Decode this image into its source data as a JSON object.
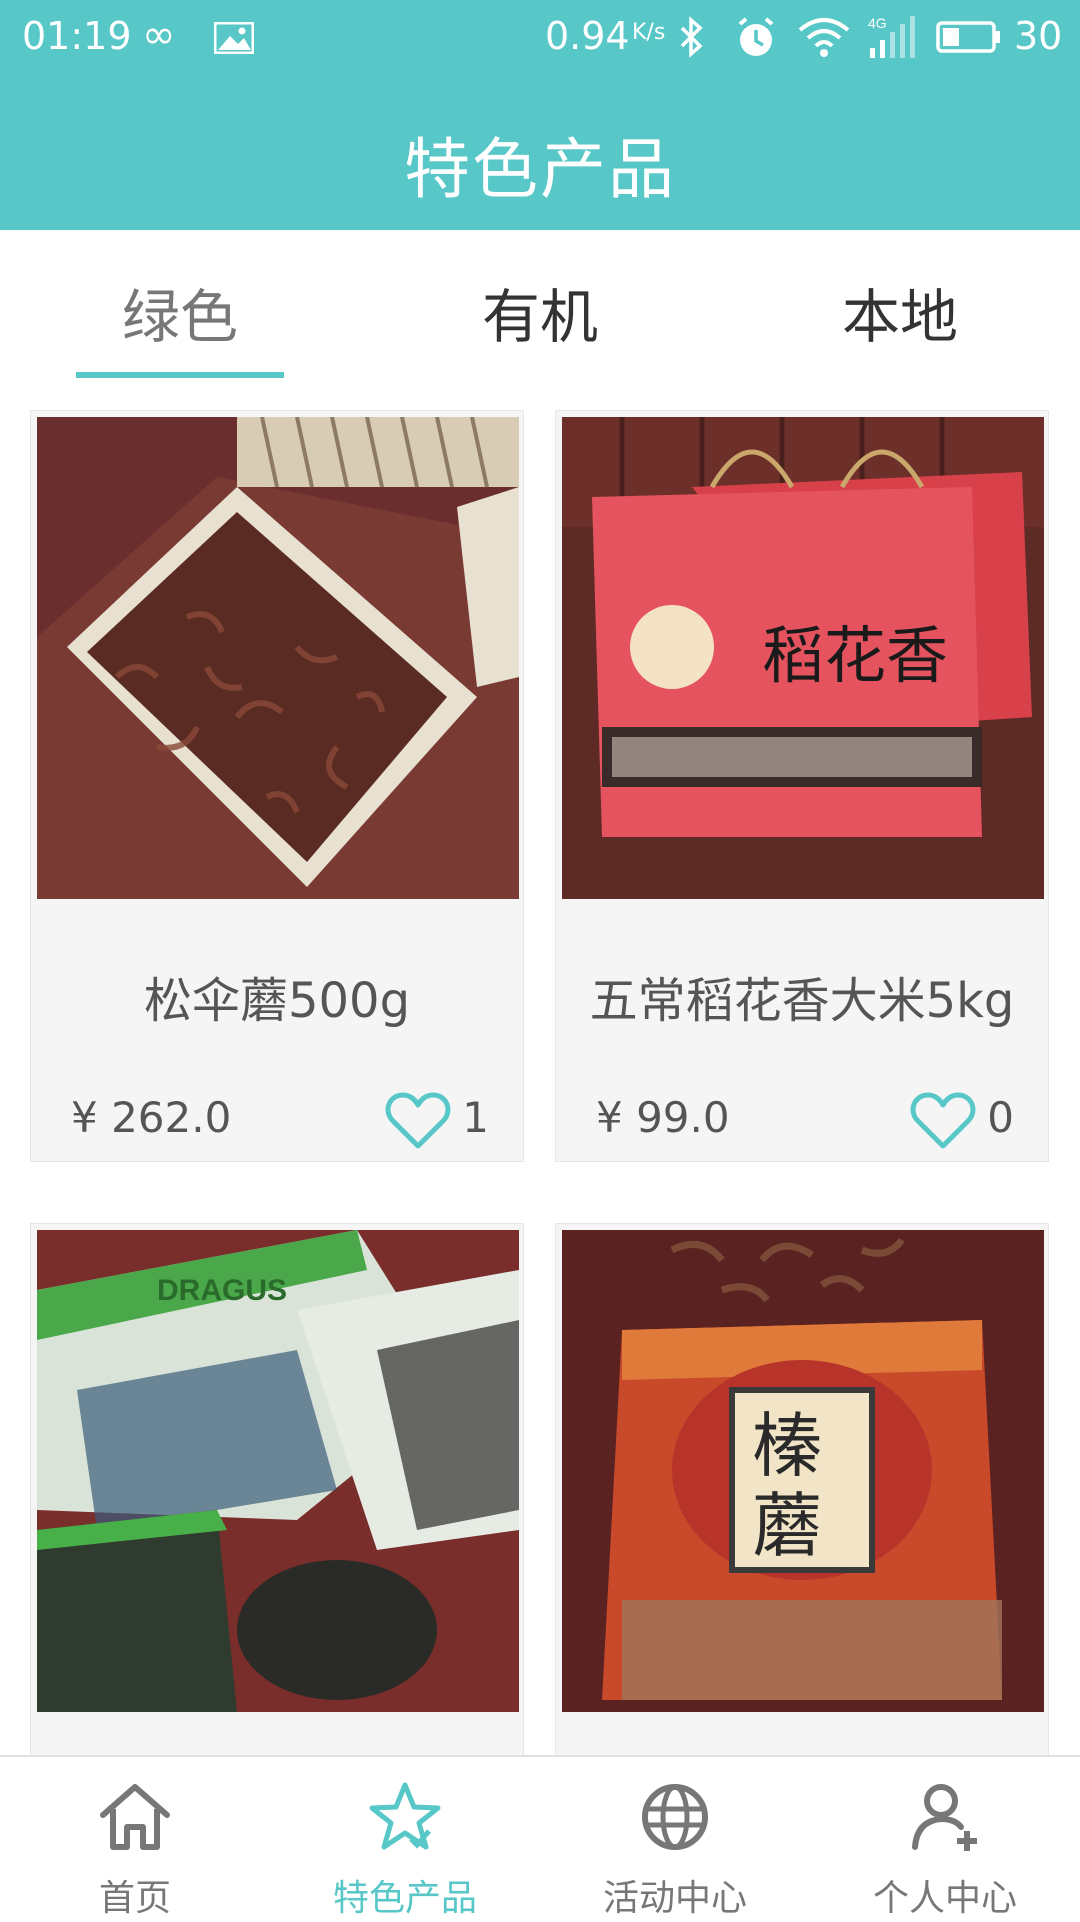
{
  "status_bar": {
    "time": "01:19",
    "network_speed": "0.94",
    "speed_unit": "K/s",
    "battery_percent": "30"
  },
  "header": {
    "title": "特色产品"
  },
  "tabs": [
    {
      "label": "绿色",
      "active": true
    },
    {
      "label": "有机",
      "active": false
    },
    {
      "label": "本地",
      "active": false
    }
  ],
  "products": [
    {
      "name": "松伞蘑500g",
      "price": "¥ 262.0",
      "likes": "1"
    },
    {
      "name": "五常稻花香大米5kg",
      "price": "¥ 99.0",
      "likes": "0"
    },
    {
      "name": "",
      "price": "",
      "likes": ""
    },
    {
      "name": "",
      "price": "",
      "likes": ""
    }
  ],
  "bottom_nav": [
    {
      "label": "首页",
      "icon": "home-icon",
      "active": false
    },
    {
      "label": "特色产品",
      "icon": "star-icon",
      "active": true
    },
    {
      "label": "活动中心",
      "icon": "globe-icon",
      "active": false
    },
    {
      "label": "个人中心",
      "icon": "user-add-icon",
      "active": false
    }
  ],
  "colors": {
    "accent": "#57c7c8",
    "background": "#ffffff",
    "card_background": "#f5f5f5",
    "text_primary": "#333333",
    "text_secondary": "#555555"
  }
}
